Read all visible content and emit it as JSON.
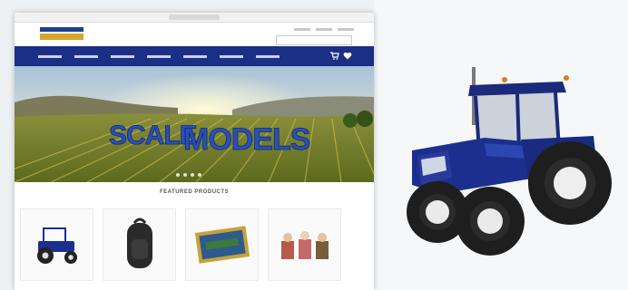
{
  "hero": {
    "headline_scale": "SCALE",
    "headline_models": "MODELS"
  },
  "featured": {
    "title": "FEATURED PRODUCTS"
  },
  "products": [
    {
      "icon": "tractor-toy-icon"
    },
    {
      "icon": "backpack-icon"
    },
    {
      "icon": "boxed-model-icon"
    },
    {
      "icon": "figurines-icon"
    }
  ],
  "colors": {
    "nav": "#1b2f86",
    "brand_yellow": "#d4a72c",
    "tractor_blue": "#1c2f8f"
  }
}
